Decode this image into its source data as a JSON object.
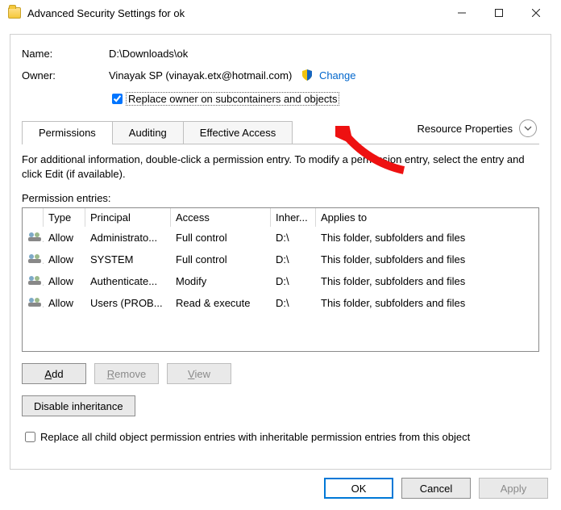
{
  "title": "Advanced Security Settings for ok",
  "labels": {
    "name": "Name:",
    "owner": "Owner:"
  },
  "name_value": "D:\\Downloads\\ok",
  "owner_value": "Vinayak SP (vinayak.etx@hotmail.com)",
  "change_link": "Change",
  "replace_owner_label": "Replace owner on subcontainers and objects",
  "replace_owner_checked": true,
  "resource_properties": "Resource Properties",
  "tabs": {
    "permissions": "Permissions",
    "auditing": "Auditing",
    "effective": "Effective Access"
  },
  "info_text": "For additional information, double-click a permission entry. To modify a permission entry, select the entry and click Edit (if available).",
  "entries_label": "Permission entries:",
  "columns": {
    "type": "Type",
    "principal": "Principal",
    "access": "Access",
    "inherited": "Inher...",
    "applies": "Applies to"
  },
  "entries": [
    {
      "type": "Allow",
      "principal": "Administrato...",
      "access": "Full control",
      "inherited": "D:\\",
      "applies": "This folder, subfolders and files"
    },
    {
      "type": "Allow",
      "principal": "SYSTEM",
      "access": "Full control",
      "inherited": "D:\\",
      "applies": "This folder, subfolders and files"
    },
    {
      "type": "Allow",
      "principal": "Authenticate...",
      "access": "Modify",
      "inherited": "D:\\",
      "applies": "This folder, subfolders and files"
    },
    {
      "type": "Allow",
      "principal": "Users (PROB...",
      "access": "Read & execute",
      "inherited": "D:\\",
      "applies": "This folder, subfolders and files"
    }
  ],
  "buttons": {
    "add": "Add",
    "remove": "Remove",
    "view": "View",
    "disable": "Disable inheritance",
    "ok": "OK",
    "cancel": "Cancel",
    "apply": "Apply"
  },
  "replace_all_label": "Replace all child object permission entries with inheritable permission entries from this object",
  "replace_all_checked": false
}
